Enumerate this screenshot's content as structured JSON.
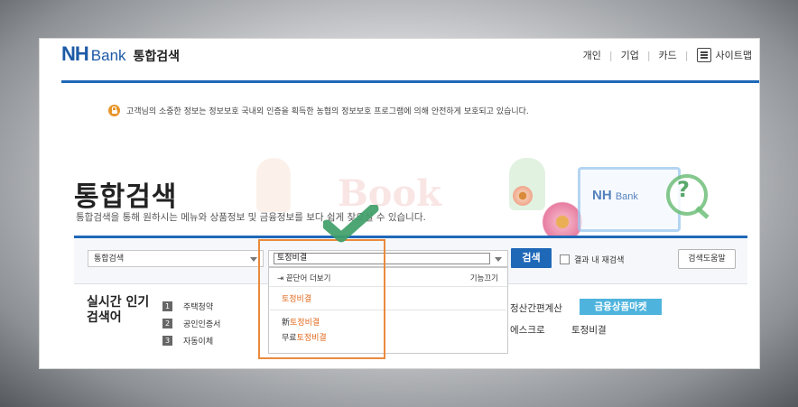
{
  "header": {
    "logo_nh": "NH",
    "logo_bank": "Bank",
    "title": "통합검색",
    "nav": [
      "개인",
      "기업",
      "카드"
    ],
    "sitemap_label": "사이트맵"
  },
  "notice": {
    "text": "고객님의 소중한 정보는 정보보호 국내외 인증을 획득한 농협의 정보보호 프로그램에 의해 안전하게 보호되고 있습니다."
  },
  "watermark": {
    "book": "Book",
    "monitor_nh": "NH",
    "monitor_bank": "Bank"
  },
  "page": {
    "title": "통합검색",
    "subtitle": "통합검색을 통해 원하시는 메뉴와 상품정보 및 금융정보를 보다 쉽게 찾으실 수 있습니다."
  },
  "search": {
    "scope_value": "통합검색",
    "query": "토정비결",
    "button_label": "검색",
    "recheck_label": "결과 내 재검색",
    "help_label": "검색도움말"
  },
  "autocomplete": {
    "more_label": "끝단어 더보기",
    "off_label": "기능끄기",
    "items": [
      {
        "prefix": "",
        "match": "토정비결"
      },
      {
        "prefix": "新",
        "match": "토정비결"
      },
      {
        "prefix": "무료",
        "match": "토정비결"
      }
    ]
  },
  "realtime": {
    "title_line1": "실시간 인기",
    "title_line2": "검색어",
    "ranks": [
      {
        "num": "1",
        "term": "주택청약"
      },
      {
        "num": "2",
        "term": "공인인증서"
      },
      {
        "num": "3",
        "term": "자동이체"
      }
    ],
    "right_top": "정산간편계산",
    "market_button": "금융상품마켓",
    "right_bottom_1": "에스크로",
    "right_bottom_2": "토정비결"
  },
  "colors": {
    "brand_blue": "#1f68b8",
    "highlight_orange": "#ea8a3d",
    "check_green": "#3f9e68",
    "market_blue": "#4fb4dd"
  }
}
